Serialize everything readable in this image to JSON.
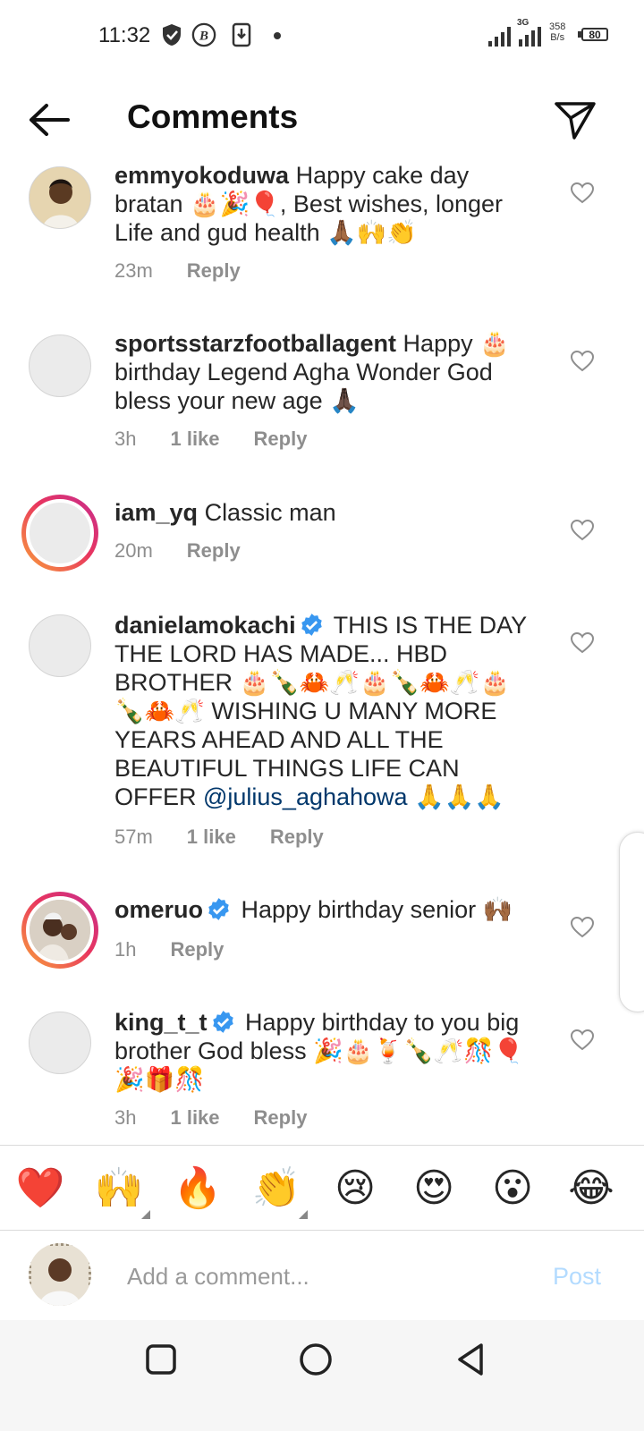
{
  "status": {
    "time": "11:32",
    "network": "3G",
    "speed_value": "358",
    "speed_unit": "B/s",
    "battery": "80"
  },
  "header": {
    "title": "Comments"
  },
  "comments": [
    {
      "user": "emmyokoduwa",
      "verified": false,
      "text": " Happy cake day bratan 🎂🎉🎈, Best wishes, longer Life and gud health 🙏🏾🙌👏",
      "mention": "",
      "text_after": "",
      "time": "23m",
      "likes": "",
      "reply": "Reply"
    },
    {
      "user": "sportsstarzfootballagent",
      "verified": false,
      "text": " Happy 🎂 birthday Legend Agha Wonder God bless your new age 🙏🏿",
      "mention": "",
      "text_after": "",
      "time": "3h",
      "likes": "1 like",
      "reply": "Reply"
    },
    {
      "user": "iam_yq",
      "verified": false,
      "text": " Classic man",
      "mention": "",
      "text_after": "",
      "time": "20m",
      "likes": "",
      "reply": "Reply"
    },
    {
      "user": "danielamokachi",
      "verified": true,
      "text": " THIS IS THE DAY THE LORD HAS MADE... HBD BROTHER 🎂🍾🦀🥂🎂🍾🦀🥂🎂🍾🦀🥂 WISHING U MANY MORE YEARS AHEAD AND ALL THE BEAUTIFUL THINGS LIFE CAN OFFER ",
      "mention": "@julius_aghahowa",
      "text_after": " 🙏🙏🙏",
      "time": "57m",
      "likes": "1 like",
      "reply": "Reply"
    },
    {
      "user": "omeruo",
      "verified": true,
      "text": " Happy birthday senior 🙌🏾",
      "mention": "",
      "text_after": "",
      "time": "1h",
      "likes": "",
      "reply": "Reply"
    },
    {
      "user": "king_t_t",
      "verified": true,
      "text": " Happy birthday to you big brother God bless 🎉🎂🍹🍾🥂🎊🎈🎉🎁🎊",
      "mention": "",
      "text_after": "",
      "time": "3h",
      "likes": "1 like",
      "reply": "Reply"
    }
  ],
  "reactions": [
    {
      "icon": "red-heart",
      "glyph": "❤️"
    },
    {
      "icon": "raising-hands",
      "glyph": "🙌"
    },
    {
      "icon": "fire",
      "glyph": "🔥"
    },
    {
      "icon": "clapping-hands",
      "glyph": "👏"
    },
    {
      "icon": "crying-face",
      "glyph": "😢"
    },
    {
      "icon": "heart-eyes-face",
      "glyph": "😍"
    },
    {
      "icon": "surprised-face",
      "glyph": "😮"
    },
    {
      "icon": "tears-of-joy-face",
      "glyph": "😂"
    }
  ],
  "composer": {
    "placeholder": "Add a comment...",
    "post_label": "Post"
  },
  "colors": {
    "link": "#00376b",
    "verified": "#3897f0",
    "post_disabled": "#b3dbff",
    "meta": "#8e8e8e"
  }
}
